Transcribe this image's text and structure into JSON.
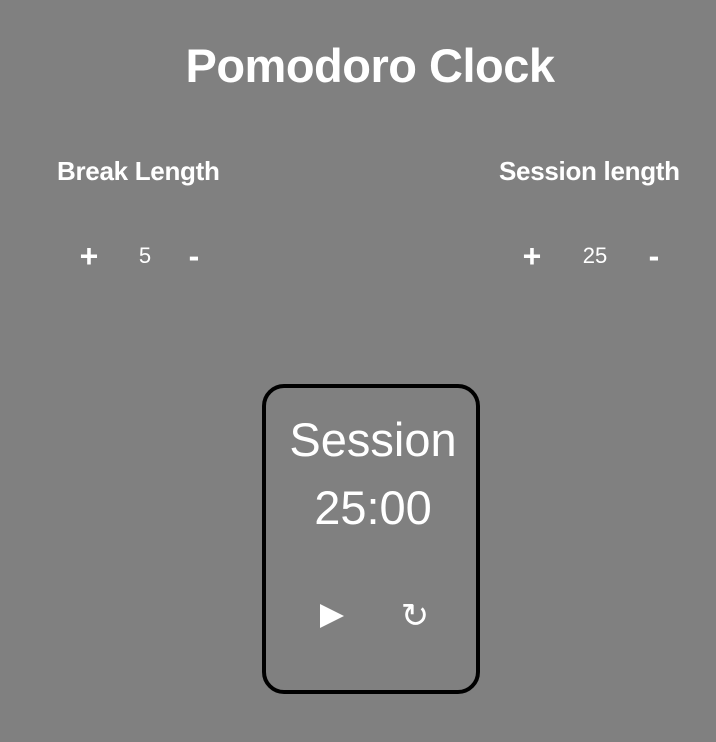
{
  "header": {
    "title": "Pomodoro Clock"
  },
  "break": {
    "label": "Break Length",
    "plus": "+",
    "value": "5",
    "minus": "-"
  },
  "session": {
    "label": "Session length",
    "plus": "+",
    "value": "25",
    "minus": "-"
  },
  "timer": {
    "label": "Session",
    "time": "25:00",
    "play_icon": "play-icon",
    "reset_icon": "reset-icon",
    "reset_glyph": "↻"
  },
  "colors": {
    "background": "#808080",
    "text": "#ffffff",
    "card_border": "#000000"
  }
}
